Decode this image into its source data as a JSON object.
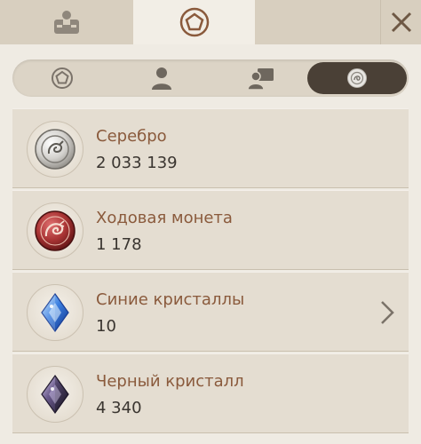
{
  "top_tabs": [
    {
      "id": "profile",
      "icon": "briefcase-person-icon",
      "active": false
    },
    {
      "id": "currency",
      "icon": "pentagon-badge-icon",
      "active": true
    }
  ],
  "close_icon": "close-icon",
  "sub_tabs": [
    {
      "icon": "pentagon-icon",
      "active": false
    },
    {
      "icon": "person-icon",
      "active": false
    },
    {
      "icon": "people-card-icon",
      "active": false
    },
    {
      "icon": "silver-coin-icon",
      "active": true
    }
  ],
  "currencies": [
    {
      "name": "Серебро",
      "amount": "2 033 139",
      "icon": "silver-coin-icon",
      "has_chevron": false
    },
    {
      "name": "Ходовая монета",
      "amount": "1 178",
      "icon": "red-dragon-coin-icon",
      "has_chevron": false
    },
    {
      "name": "Синие кристаллы",
      "amount": "10",
      "icon": "blue-crystal-icon",
      "has_chevron": true
    },
    {
      "name": "Черный кристалл",
      "amount": "4 340",
      "icon": "black-crystal-icon",
      "has_chevron": false
    }
  ],
  "colors": {
    "active_tab_bg": "#4a4036",
    "name_text": "#8a5a3c",
    "amount_text": "#3a3530",
    "icon_accent": "#8a5a3c"
  }
}
